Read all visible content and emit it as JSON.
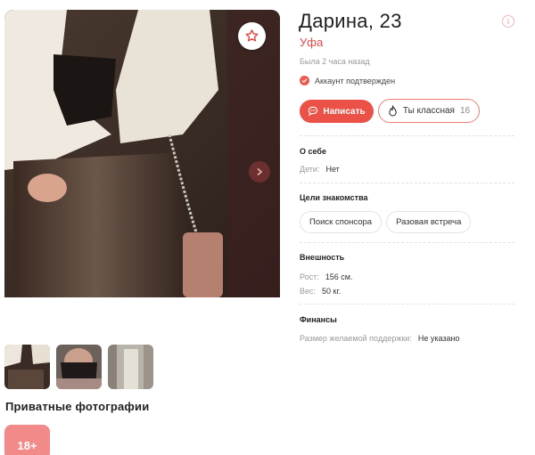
{
  "profile": {
    "name_age": "Дарина, 23",
    "city": "Уфа",
    "last_seen": "Была 2 часа назад",
    "verified_label": "Аккаунт подтвержден"
  },
  "actions": {
    "write_label": "Написать",
    "like_label": "Ты классная",
    "like_count": "16"
  },
  "about": {
    "title": "О себе",
    "children_key": "Дети:",
    "children_value": "Нет"
  },
  "goals": {
    "title": "Цели знакомства",
    "tags": [
      "Поиск спонсора",
      "Разовая встреча"
    ]
  },
  "appearance": {
    "title": "Внешность",
    "height_key": "Рост:",
    "height_value": "156 см.",
    "weight_key": "Вес:",
    "weight_value": "50 кг."
  },
  "finances": {
    "title": "Финансы",
    "support_key": "Размер желаемой поддержки:",
    "support_value": "Не указано"
  },
  "private_photos": {
    "title": "Приватные фотографии",
    "badge": "18+"
  },
  "icons": {
    "favorite": "star-icon",
    "next": "chevron-right-icon",
    "info": "info-icon",
    "verified": "check-icon",
    "chat": "chat-bubble-icon",
    "flame": "flame-icon"
  },
  "colors": {
    "accent": "#ec5147",
    "city": "#e74a4a",
    "badge": "#f38a8a"
  }
}
